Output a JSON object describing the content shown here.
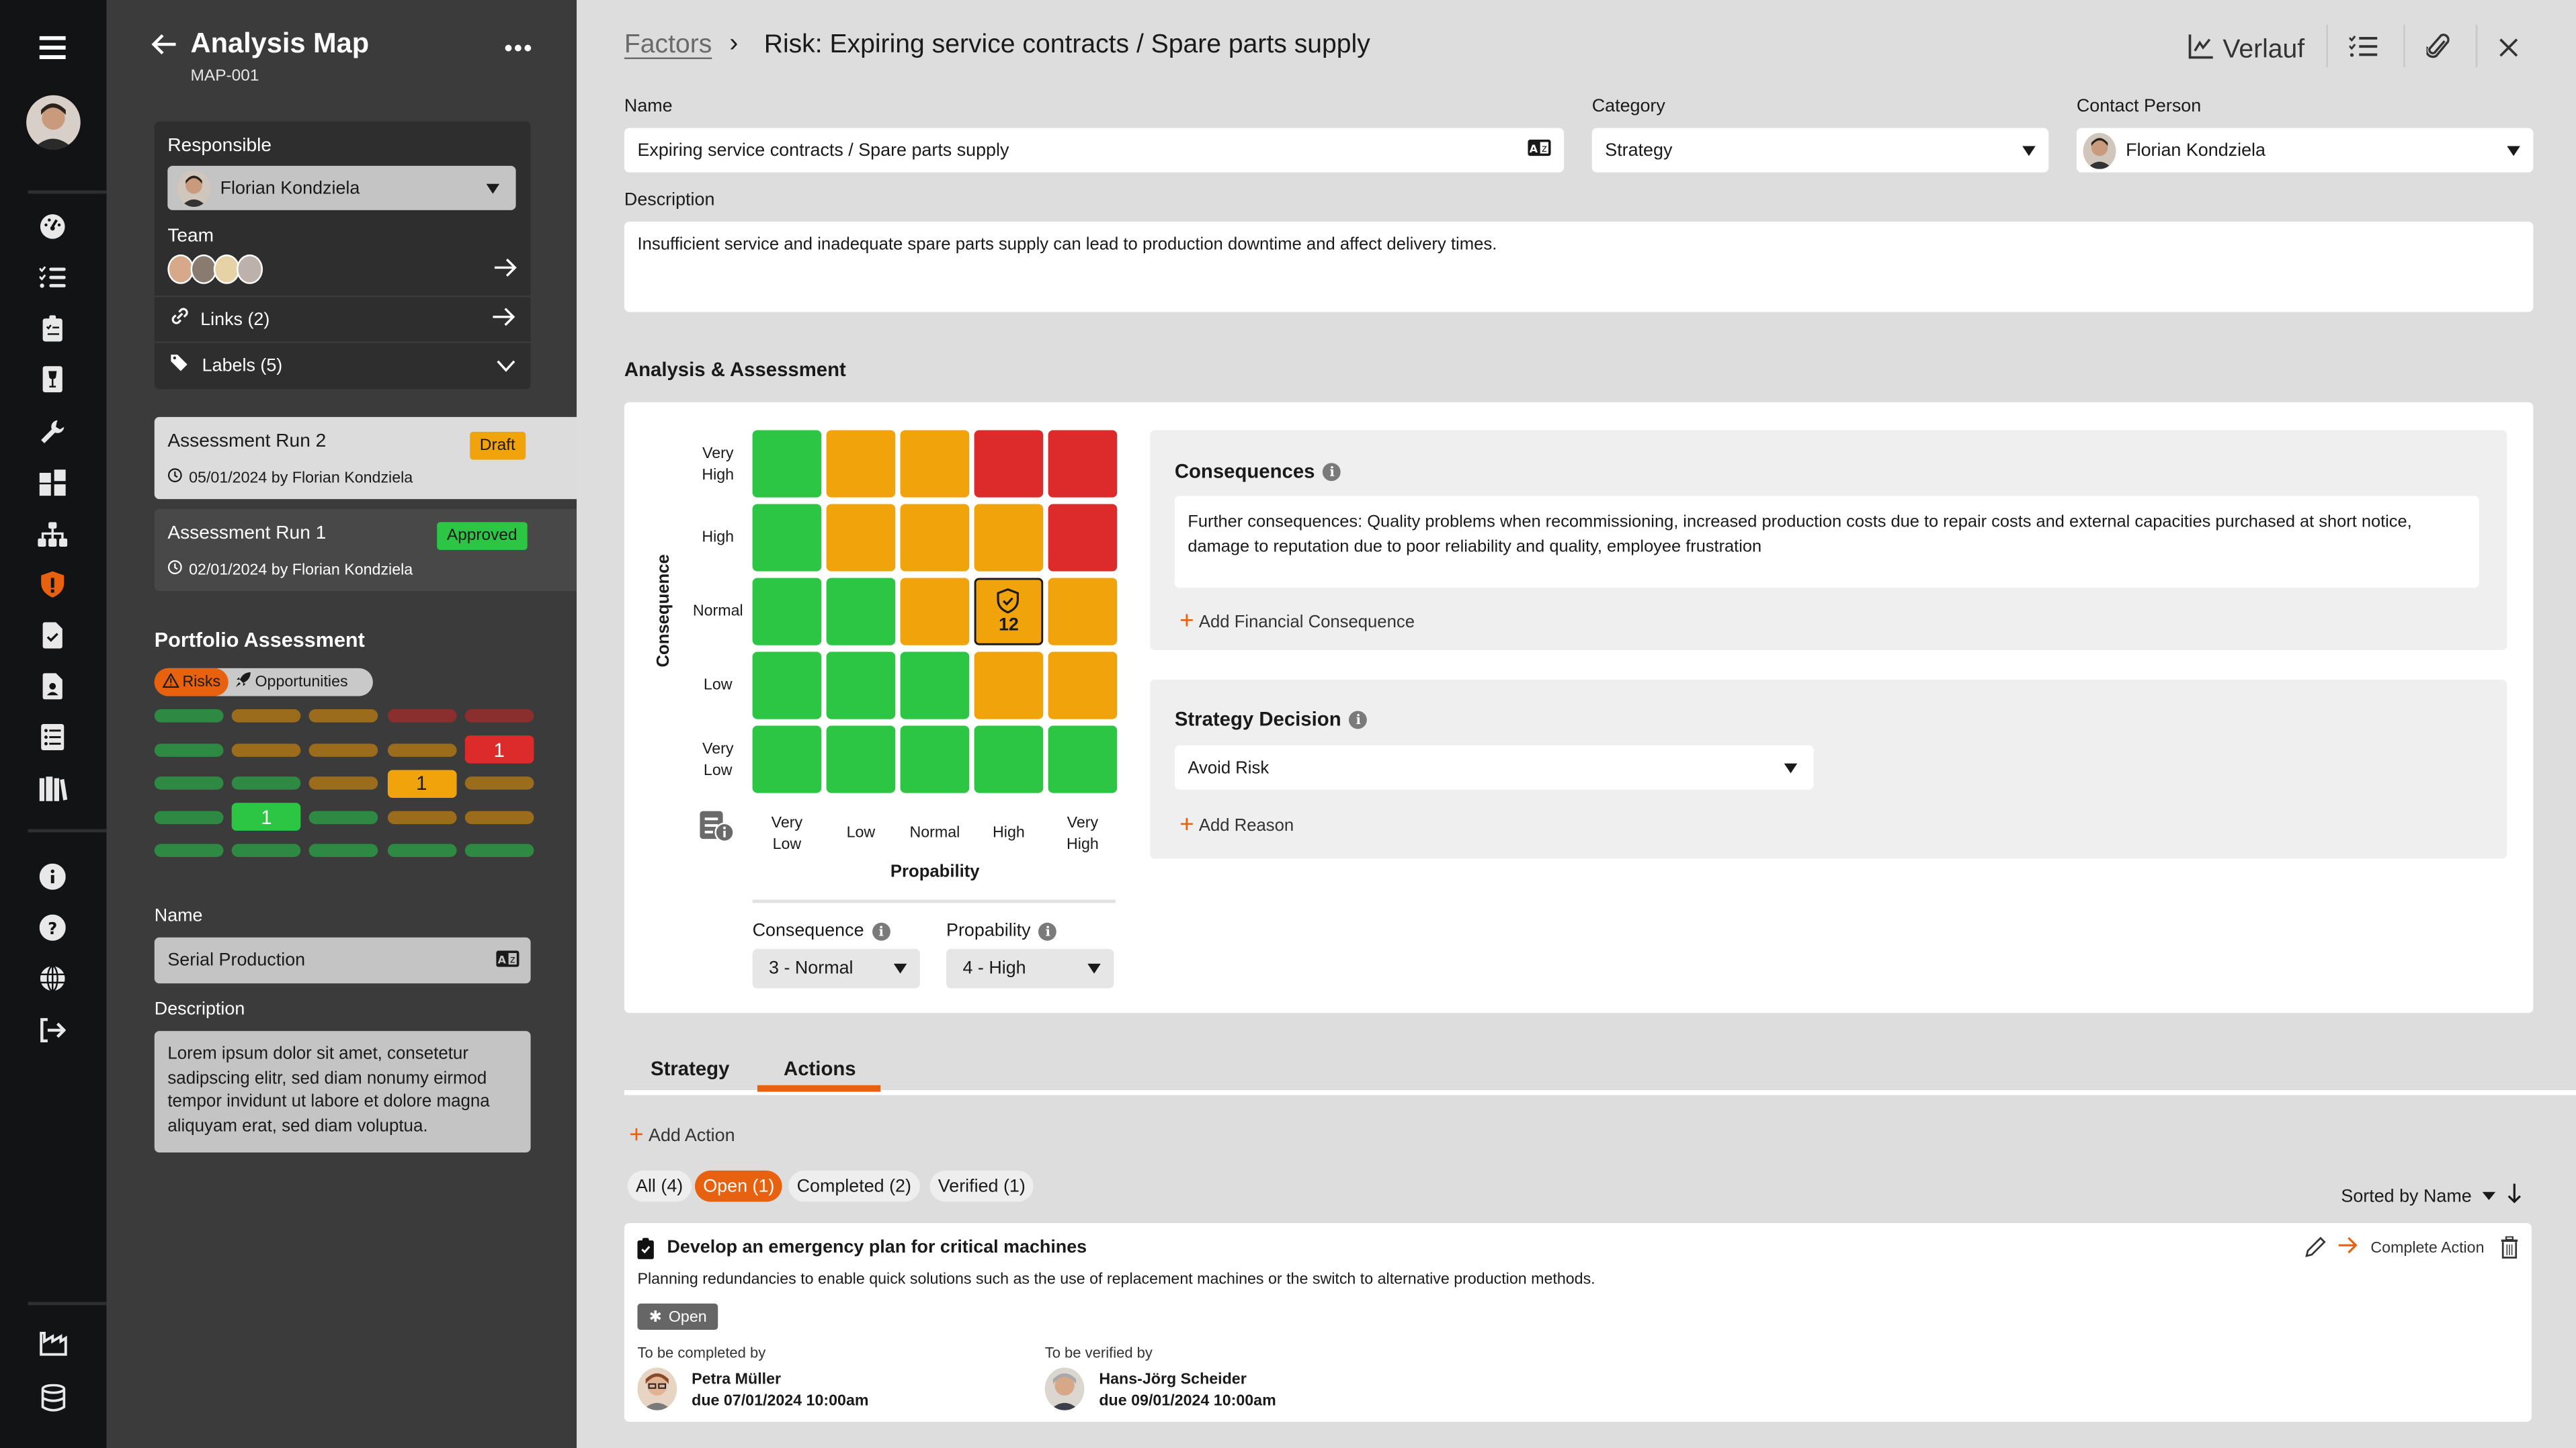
{
  "rail": {
    "icons": [
      "menu-icon",
      "dashboard-icon",
      "checklist-icon",
      "clipboard-icon",
      "fragile-icon",
      "wrench-icon",
      "puzzle-icon",
      "hierarchy-icon",
      "risk-shield-icon",
      "document-check-icon",
      "document-person-icon",
      "list-icon",
      "library-icon",
      "info-icon",
      "help-icon",
      "globe-icon",
      "logout-icon",
      "factory-icon",
      "database-icon"
    ],
    "active_color": "#e8610e"
  },
  "panel": {
    "title": "Analysis Map",
    "subtitle": "MAP-001",
    "responsible_label": "Responsible",
    "responsible_value": "Florian Kondziela",
    "team_label": "Team",
    "links_label": "Links (2)",
    "labels_label": "Labels (5)",
    "runs": [
      {
        "title": "Assessment Run 2",
        "meta": "05/01/2024 by Florian Kondziela",
        "status": "Draft",
        "status_color": "#f0a30a",
        "selected": true
      },
      {
        "title": "Assessment Run 1",
        "meta": "02/01/2024 by Florian Kondziela",
        "status": "Approved",
        "status_color": "#2dc644",
        "selected": false
      }
    ],
    "portfolio_title": "Portfolio Assessment",
    "toggle": {
      "risks": "Risks",
      "opportunities": "Opportunities",
      "active": "risks"
    },
    "portfolio_grid": [
      [
        "g",
        "o",
        "o",
        "r",
        "r"
      ],
      [
        "g",
        "o",
        "o",
        "o",
        "r"
      ],
      [
        "g",
        "g",
        "o",
        "o",
        "o"
      ],
      [
        "g",
        "g",
        "g",
        "o",
        "o"
      ],
      [
        "g",
        "g",
        "g",
        "g",
        "g"
      ]
    ],
    "portfolio_counts": [
      {
        "row": 1,
        "col": 4,
        "count": "1"
      },
      {
        "row": 2,
        "col": 3,
        "count": "1"
      },
      {
        "row": 3,
        "col": 1,
        "count": "1"
      }
    ],
    "name_label": "Name",
    "name_value": "Serial Production",
    "description_label": "Description",
    "description_value": "Lorem ipsum dolor sit amet, consetetur sadipscing elitr, sed diam nonumy eirmod tempor invidunt ut labore et dolore magna aliquyam erat, sed diam voluptua."
  },
  "header": {
    "breadcrumb_parent": "Factors",
    "breadcrumb_sep": "›",
    "title": "Risk: Expiring service contracts / Spare parts supply",
    "history_label": "Verlauf"
  },
  "form": {
    "name_label": "Name",
    "name_value": "Expiring service contracts / Spare parts supply",
    "category_label": "Category",
    "category_value": "Strategy",
    "contact_label": "Contact Person",
    "contact_value": "Florian Kondziela",
    "description_label": "Description",
    "description_value": "Insufficient service and inadequate spare parts supply can lead to production downtime and affect delivery times."
  },
  "assessment": {
    "section_title": "Analysis & Assessment",
    "y_axis_title": "Consequence",
    "x_axis_title": "Propability",
    "y_labels": [
      "Very\nHigh",
      "High",
      "Normal",
      "Low",
      "Very\nLow"
    ],
    "x_labels": [
      "Very\nLow",
      "Low",
      "Normal",
      "High",
      "Very\nHigh"
    ],
    "matrix": [
      [
        "g",
        "o",
        "o",
        "r",
        "r"
      ],
      [
        "g",
        "o",
        "o",
        "o",
        "r"
      ],
      [
        "g",
        "g",
        "o",
        "o",
        "o"
      ],
      [
        "g",
        "g",
        "g",
        "o",
        "o"
      ],
      [
        "g",
        "g",
        "g",
        "g",
        "g"
      ]
    ],
    "selected": {
      "row": 2,
      "col": 3,
      "score": "12"
    },
    "colors": {
      "g": "#2dc644",
      "o": "#f0a30a",
      "r": "#dd2a2a"
    },
    "consequence_label": "Consequence",
    "consequence_value": "3 - Normal",
    "probability_label": "Propability",
    "probability_value": "4 - High",
    "consequences_title": "Consequences",
    "consequences_text": "Further consequences: Quality problems when recommissioning, increased production costs due to repair costs and external capacities purchased at short notice, damage to reputation due to poor reliability and quality, employee frustration",
    "add_financial": "Add Financial Consequence",
    "strategy_title": "Strategy Decision",
    "strategy_value": "Avoid Risk",
    "add_reason": "Add Reason"
  },
  "tabs": [
    {
      "label": "Strategy",
      "active": false
    },
    {
      "label": "Actions",
      "active": true
    }
  ],
  "actions": {
    "add_label": "Add Action",
    "filters": [
      {
        "label": "All (4)",
        "active": false
      },
      {
        "label": "Open (1)",
        "active": true
      },
      {
        "label": "Completed (2)",
        "active": false
      },
      {
        "label": "Verified (1)",
        "active": false
      }
    ],
    "sort_label": "Sorted by Name",
    "items": [
      {
        "title": "Develop an emergency plan for critical machines",
        "description": "Planning redundancies to enable quick solutions such as the use of replacement machines or the switch to alternative production methods.",
        "status": "Open",
        "complete_label": "Complete Action",
        "completed_by_label": "To be completed by",
        "completed_by_name": "Petra Müller",
        "completed_by_due": "due 07/01/2024 10:00am",
        "verified_by_label": "To be verified by",
        "verified_by_name": "Hans-Jörg Scheider",
        "verified_by_due": "due 09/01/2024 10:00am"
      }
    ]
  }
}
